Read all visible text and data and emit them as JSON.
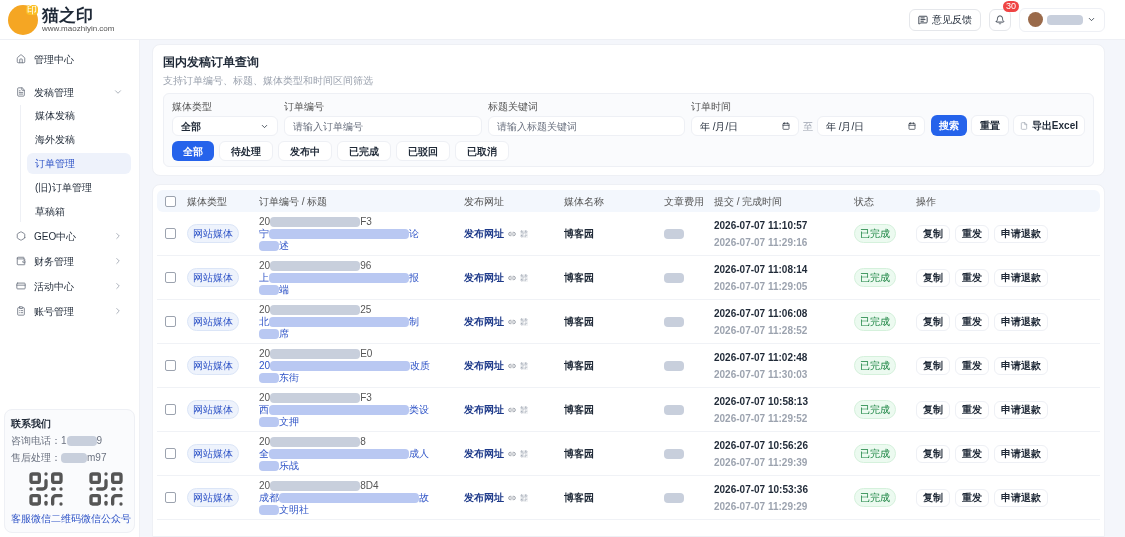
{
  "brand": {
    "name": "猫之印",
    "url": "www.maozhiyin.com",
    "badge": "印"
  },
  "sidebar": {
    "items": [
      {
        "label": "管理中心",
        "has_arrow": false
      },
      {
        "label": "发稿管理",
        "expanded": true,
        "has_arrow": true,
        "children": [
          {
            "label": "媒体发稿",
            "selected": false
          },
          {
            "label": "海外发稿",
            "selected": false
          },
          {
            "label": "订单管理",
            "selected": true
          },
          {
            "label": "(旧)订单管理",
            "selected": false
          },
          {
            "label": "草稿箱",
            "selected": false
          }
        ]
      },
      {
        "label": "GEO中心",
        "expanded": false,
        "has_arrow": true
      },
      {
        "label": "财务管理",
        "expanded": false,
        "has_arrow": true
      },
      {
        "label": "活动中心",
        "expanded": false,
        "has_arrow": true
      },
      {
        "label": "账号管理",
        "expanded": false,
        "has_arrow": true
      }
    ]
  },
  "contact": {
    "title": "联系我们",
    "phone_label": "咨询电话：",
    "phone_start": "1",
    "phone_end": "9",
    "after_label": "售后处理：",
    "after_end": "m97",
    "qr_captions": [
      "客服微信二维码",
      "微信公众号"
    ]
  },
  "header": {
    "feedback": "意见反馈",
    "notification_count": "30"
  },
  "filter": {
    "title": "国内发稿订单查询",
    "subtitle": "支持订单编号、标题、媒体类型和时间区间筛选",
    "media_type": {
      "label": "媒体类型",
      "value": "全部"
    },
    "order_no": {
      "label": "订单编号",
      "placeholder": "请输入订单编号"
    },
    "keyword": {
      "label": "标题关键词",
      "placeholder": "请输入标题关键词"
    },
    "time": {
      "label": "订单时间",
      "from": "年 /月/日",
      "separator": "至",
      "to": "年 /月/日"
    },
    "buttons": [
      {
        "label": "搜索",
        "kind": "primary"
      },
      {
        "label": "重置",
        "kind": "plain"
      },
      {
        "label": "导出Excel",
        "kind": "export"
      }
    ],
    "status_tabs": [
      {
        "label": "全部",
        "selected": true
      },
      {
        "label": "待处理",
        "selected": false
      },
      {
        "label": "发布中",
        "selected": false
      },
      {
        "label": "已完成",
        "selected": false
      },
      {
        "label": "已驳回",
        "selected": false
      },
      {
        "label": "已取消",
        "selected": false
      }
    ]
  },
  "table": {
    "all_checked": false,
    "columns": [
      "媒体类型",
      "订单编号 / 标题",
      "发布网址",
      "媒体名称",
      "文章费用",
      "提交 / 完成时间",
      "状态",
      "操作"
    ],
    "rows": [
      {
        "checked": false,
        "media_type": "网站媒体",
        "order_start": "20",
        "order_end": "F3",
        "title_start": "宁",
        "title_end": "论",
        "title_line2": "述",
        "url": "发布网址",
        "media_name": "博客园",
        "submitted": "2026-07-07 11:10:57",
        "completed": "2026-07-07 11:29:16",
        "status": "已完成",
        "actions": [
          "复制",
          "重发",
          "申请退款"
        ]
      },
      {
        "checked": false,
        "media_type": "网站媒体",
        "order_start": "20",
        "order_end": "96",
        "title_start": "上",
        "title_end": "报",
        "title_line2": "端",
        "url": "发布网址",
        "media_name": "博客园",
        "submitted": "2026-07-07 11:08:14",
        "completed": "2026-07-07 11:29:05",
        "status": "已完成",
        "actions": [
          "复制",
          "重发",
          "申请退款"
        ]
      },
      {
        "checked": false,
        "media_type": "网站媒体",
        "order_start": "20",
        "order_end": "25",
        "title_start": "北",
        "title_end": "制",
        "title_line2": "席",
        "url": "发布网址",
        "media_name": "博客园",
        "submitted": "2026-07-07 11:06:08",
        "completed": "2026-07-07 11:28:52",
        "status": "已完成",
        "actions": [
          "复制",
          "重发",
          "申请退款"
        ]
      },
      {
        "checked": false,
        "media_type": "网站媒体",
        "order_start": "20",
        "order_end": "E0",
        "title_start": "20",
        "title_end": "改质",
        "title_line2": "东街",
        "url": "发布网址",
        "media_name": "博客园",
        "submitted": "2026-07-07 11:02:48",
        "completed": "2026-07-07 11:30:03",
        "status": "已完成",
        "actions": [
          "复制",
          "重发",
          "申请退款"
        ]
      },
      {
        "checked": false,
        "media_type": "网站媒体",
        "order_start": "20",
        "order_end": "F3",
        "title_start": "西",
        "title_end": "类设",
        "title_line2": "文押",
        "url": "发布网址",
        "media_name": "博客园",
        "submitted": "2026-07-07 10:58:13",
        "completed": "2026-07-07 11:29:52",
        "status": "已完成",
        "actions": [
          "复制",
          "重发",
          "申请退款"
        ]
      },
      {
        "checked": false,
        "media_type": "网站媒体",
        "order_start": "20",
        "order_end": "8",
        "title_start": "全",
        "title_end": "成人",
        "title_line2": "乐战",
        "url": "发布网址",
        "media_name": "博客园",
        "submitted": "2026-07-07 10:56:26",
        "completed": "2026-07-07 11:29:39",
        "status": "已完成",
        "actions": [
          "复制",
          "重发",
          "申请退款"
        ]
      },
      {
        "checked": false,
        "media_type": "网站媒体",
        "order_start": "20",
        "order_end": "8D4",
        "title_start": "成都",
        "title_end": "故",
        "title_line2": "文明社",
        "url": "发布网址",
        "media_name": "博客园",
        "submitted": "2026-07-07 10:53:36",
        "completed": "2026-07-07 11:29:29",
        "status": "已完成",
        "actions": [
          "复制",
          "重发",
          "申请退款"
        ]
      }
    ]
  }
}
